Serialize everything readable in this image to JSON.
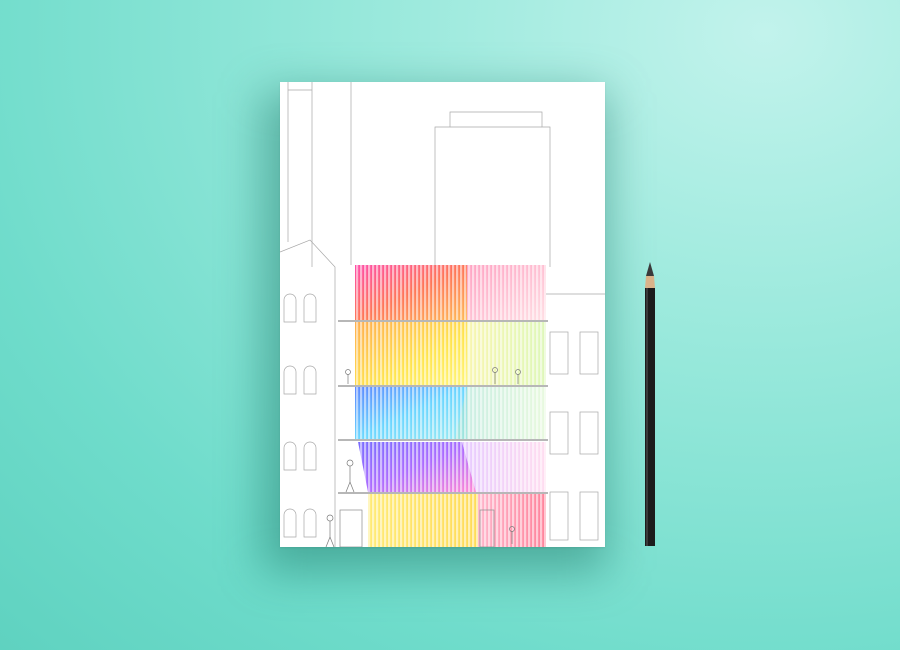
{
  "scene": {
    "background_color": "#7ddfcf",
    "paper_color": "#ffffff",
    "pencil_color": "#1c1c1c",
    "pencil_wood_color": "#d9b38a",
    "line_color": "#9a9a9a",
    "watercolor_palette": [
      "#ff3fa0",
      "#ffb347",
      "#fff04a",
      "#b6f06b",
      "#5ad1ff",
      "#4b7bff",
      "#a35cff",
      "#ff7ad1"
    ]
  }
}
